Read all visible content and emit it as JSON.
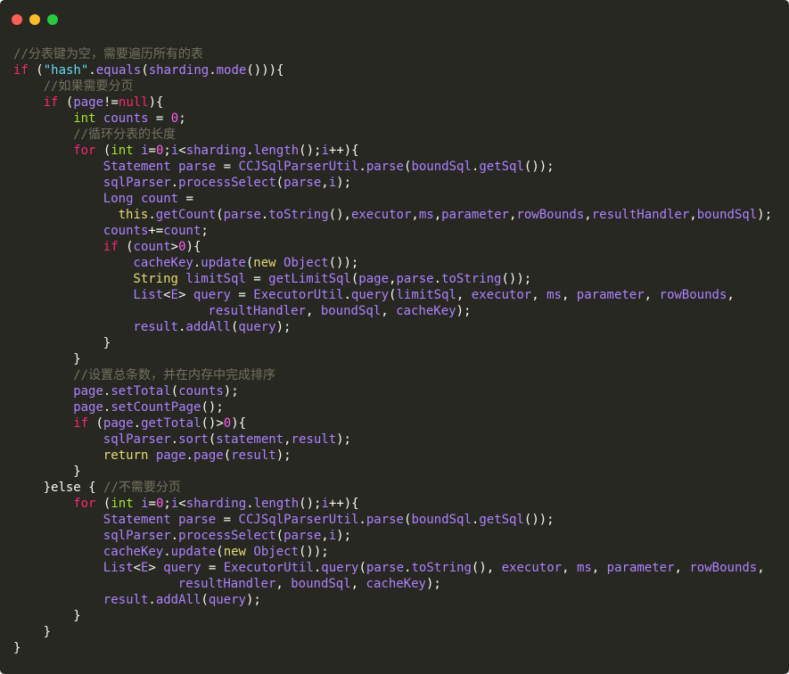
{
  "window": {
    "controls": {
      "close": "close",
      "minimize": "minimize",
      "maximize": "maximize"
    },
    "colors": {
      "close": "#ff5f56",
      "minimize": "#ffbd2e",
      "maximize": "#27c93f",
      "background": "#272822"
    }
  },
  "code_lines": [
    {
      "indent": 0,
      "tokens": [
        {
          "t": "//分表键为空，需要遍历所有的表",
          "c": "cm"
        }
      ]
    },
    {
      "indent": 0,
      "tokens": [
        {
          "t": "if",
          "c": "kw"
        },
        {
          "t": " ("
        },
        {
          "t": "\"hash\"",
          "c": "str"
        },
        {
          "t": "."
        },
        {
          "t": "equals",
          "c": "var"
        },
        {
          "t": "("
        },
        {
          "t": "sharding",
          "c": "var"
        },
        {
          "t": "."
        },
        {
          "t": "mode",
          "c": "var"
        },
        {
          "t": "())){"
        }
      ]
    },
    {
      "indent": 1,
      "tokens": [
        {
          "t": "//如果需要分页",
          "c": "cm"
        }
      ]
    },
    {
      "indent": 1,
      "tokens": [
        {
          "t": "if",
          "c": "kw"
        },
        {
          "t": " ("
        },
        {
          "t": "page",
          "c": "var"
        },
        {
          "t": "!="
        },
        {
          "t": "null",
          "c": "kw"
        },
        {
          "t": "){"
        }
      ]
    },
    {
      "indent": 2,
      "tokens": [
        {
          "t": "int",
          "c": "type"
        },
        {
          "t": " "
        },
        {
          "t": "counts",
          "c": "var"
        },
        {
          "t": " = "
        },
        {
          "t": "0",
          "c": "num"
        },
        {
          "t": ";"
        }
      ]
    },
    {
      "indent": 2,
      "tokens": [
        {
          "t": "//循环分表的长度",
          "c": "cm"
        }
      ]
    },
    {
      "indent": 2,
      "tokens": [
        {
          "t": "for",
          "c": "kw"
        },
        {
          "t": " ("
        },
        {
          "t": "int",
          "c": "type"
        },
        {
          "t": " "
        },
        {
          "t": "i",
          "c": "var"
        },
        {
          "t": "="
        },
        {
          "t": "0",
          "c": "num"
        },
        {
          "t": ";"
        },
        {
          "t": "i",
          "c": "var"
        },
        {
          "t": "<"
        },
        {
          "t": "sharding",
          "c": "var"
        },
        {
          "t": "."
        },
        {
          "t": "length",
          "c": "var"
        },
        {
          "t": "();"
        },
        {
          "t": "i",
          "c": "var"
        },
        {
          "t": "++){"
        }
      ]
    },
    {
      "indent": 3,
      "tokens": [
        {
          "t": "Statement",
          "c": "var"
        },
        {
          "t": " "
        },
        {
          "t": "parse",
          "c": "var"
        },
        {
          "t": " = "
        },
        {
          "t": "CCJSqlParserUtil",
          "c": "var"
        },
        {
          "t": "."
        },
        {
          "t": "parse",
          "c": "var"
        },
        {
          "t": "("
        },
        {
          "t": "boundSql",
          "c": "var"
        },
        {
          "t": "."
        },
        {
          "t": "getSql",
          "c": "var"
        },
        {
          "t": "());"
        }
      ]
    },
    {
      "indent": 3,
      "tokens": [
        {
          "t": "sqlParser",
          "c": "var"
        },
        {
          "t": "."
        },
        {
          "t": "processSelect",
          "c": "var"
        },
        {
          "t": "("
        },
        {
          "t": "parse",
          "c": "var"
        },
        {
          "t": ","
        },
        {
          "t": "i",
          "c": "var"
        },
        {
          "t": ");"
        }
      ]
    },
    {
      "indent": 3,
      "tokens": [
        {
          "t": "Long",
          "c": "var"
        },
        {
          "t": " "
        },
        {
          "t": "count",
          "c": "var"
        },
        {
          "t": " ="
        }
      ]
    },
    {
      "indent": 3,
      "pad": 2,
      "tokens": [
        {
          "t": "this",
          "c": "fn"
        },
        {
          "t": "."
        },
        {
          "t": "getCount",
          "c": "var"
        },
        {
          "t": "("
        },
        {
          "t": "parse",
          "c": "var"
        },
        {
          "t": "."
        },
        {
          "t": "toString",
          "c": "var"
        },
        {
          "t": "(),"
        },
        {
          "t": "executor",
          "c": "var"
        },
        {
          "t": ","
        },
        {
          "t": "ms",
          "c": "var"
        },
        {
          "t": ","
        },
        {
          "t": "parameter",
          "c": "var"
        },
        {
          "t": ","
        },
        {
          "t": "rowBounds",
          "c": "var"
        },
        {
          "t": ","
        },
        {
          "t": "resultHandler",
          "c": "var"
        },
        {
          "t": ","
        },
        {
          "t": "boundSql",
          "c": "var"
        },
        {
          "t": ");"
        }
      ]
    },
    {
      "indent": 3,
      "tokens": [
        {
          "t": "counts",
          "c": "var"
        },
        {
          "t": "+="
        },
        {
          "t": "count",
          "c": "var"
        },
        {
          "t": ";"
        }
      ]
    },
    {
      "indent": 3,
      "tokens": [
        {
          "t": "if",
          "c": "kw"
        },
        {
          "t": " ("
        },
        {
          "t": "count",
          "c": "var"
        },
        {
          "t": ">"
        },
        {
          "t": "0",
          "c": "num"
        },
        {
          "t": "){"
        }
      ]
    },
    {
      "indent": 4,
      "tokens": [
        {
          "t": "cacheKey",
          "c": "var"
        },
        {
          "t": "."
        },
        {
          "t": "update",
          "c": "var"
        },
        {
          "t": "("
        },
        {
          "t": "new",
          "c": "fn"
        },
        {
          "t": " "
        },
        {
          "t": "Object",
          "c": "var"
        },
        {
          "t": "());"
        }
      ]
    },
    {
      "indent": 4,
      "tokens": [
        {
          "t": "String",
          "c": "fn"
        },
        {
          "t": " "
        },
        {
          "t": "limitSql",
          "c": "var"
        },
        {
          "t": " = "
        },
        {
          "t": "getLimitSql",
          "c": "var"
        },
        {
          "t": "("
        },
        {
          "t": "page",
          "c": "var"
        },
        {
          "t": ","
        },
        {
          "t": "parse",
          "c": "var"
        },
        {
          "t": "."
        },
        {
          "t": "toString",
          "c": "var"
        },
        {
          "t": "());"
        }
      ]
    },
    {
      "indent": 4,
      "tokens": [
        {
          "t": "List",
          "c": "var"
        },
        {
          "t": "<"
        },
        {
          "t": "E",
          "c": "var"
        },
        {
          "t": "> "
        },
        {
          "t": "query",
          "c": "var"
        },
        {
          "t": " = "
        },
        {
          "t": "ExecutorUtil",
          "c": "var"
        },
        {
          "t": "."
        },
        {
          "t": "query",
          "c": "var"
        },
        {
          "t": "("
        },
        {
          "t": "limitSql",
          "c": "var"
        },
        {
          "t": ", "
        },
        {
          "t": "executor",
          "c": "var"
        },
        {
          "t": ", "
        },
        {
          "t": "ms",
          "c": "var"
        },
        {
          "t": ", "
        },
        {
          "t": "parameter",
          "c": "var"
        },
        {
          "t": ", "
        },
        {
          "t": "rowBounds",
          "c": "var"
        },
        {
          "t": ","
        }
      ]
    },
    {
      "indent": 4,
      "pad": 10,
      "tokens": [
        {
          "t": "resultHandler",
          "c": "var"
        },
        {
          "t": ", "
        },
        {
          "t": "boundSql",
          "c": "var"
        },
        {
          "t": ", "
        },
        {
          "t": "cacheKey",
          "c": "var"
        },
        {
          "t": ");"
        }
      ]
    },
    {
      "indent": 4,
      "tokens": [
        {
          "t": "result",
          "c": "var"
        },
        {
          "t": "."
        },
        {
          "t": "addAll",
          "c": "var"
        },
        {
          "t": "("
        },
        {
          "t": "query",
          "c": "var"
        },
        {
          "t": ");"
        }
      ]
    },
    {
      "indent": 3,
      "tokens": [
        {
          "t": "}"
        }
      ]
    },
    {
      "indent": 2,
      "tokens": [
        {
          "t": "}"
        }
      ]
    },
    {
      "indent": 2,
      "tokens": [
        {
          "t": "//设置总条数，并在内存中完成排序",
          "c": "cm"
        }
      ]
    },
    {
      "indent": 2,
      "tokens": [
        {
          "t": "page",
          "c": "var"
        },
        {
          "t": "."
        },
        {
          "t": "setTotal",
          "c": "var"
        },
        {
          "t": "("
        },
        {
          "t": "counts",
          "c": "var"
        },
        {
          "t": ");"
        }
      ]
    },
    {
      "indent": 2,
      "tokens": [
        {
          "t": "page",
          "c": "var"
        },
        {
          "t": "."
        },
        {
          "t": "setCountPage",
          "c": "var"
        },
        {
          "t": "();"
        }
      ]
    },
    {
      "indent": 2,
      "tokens": [
        {
          "t": "if",
          "c": "kw"
        },
        {
          "t": " ("
        },
        {
          "t": "page",
          "c": "var"
        },
        {
          "t": "."
        },
        {
          "t": "getTotal",
          "c": "var"
        },
        {
          "t": "()>"
        },
        {
          "t": "0",
          "c": "num"
        },
        {
          "t": "){"
        }
      ]
    },
    {
      "indent": 3,
      "tokens": [
        {
          "t": "sqlParser",
          "c": "var"
        },
        {
          "t": "."
        },
        {
          "t": "sort",
          "c": "var"
        },
        {
          "t": "("
        },
        {
          "t": "statement",
          "c": "var"
        },
        {
          "t": ","
        },
        {
          "t": "result",
          "c": "var"
        },
        {
          "t": ");"
        }
      ]
    },
    {
      "indent": 3,
      "tokens": [
        {
          "t": "return",
          "c": "fn"
        },
        {
          "t": " "
        },
        {
          "t": "page",
          "c": "var"
        },
        {
          "t": "."
        },
        {
          "t": "page",
          "c": "var"
        },
        {
          "t": "("
        },
        {
          "t": "result",
          "c": "var"
        },
        {
          "t": ");"
        }
      ]
    },
    {
      "indent": 2,
      "tokens": [
        {
          "t": "}"
        }
      ]
    },
    {
      "indent": 1,
      "tokens": [
        {
          "t": "}else { "
        },
        {
          "t": "//不需要分页",
          "c": "cm"
        }
      ]
    },
    {
      "indent": 2,
      "tokens": [
        {
          "t": "for",
          "c": "kw"
        },
        {
          "t": " ("
        },
        {
          "t": "int",
          "c": "type"
        },
        {
          "t": " "
        },
        {
          "t": "i",
          "c": "var"
        },
        {
          "t": "="
        },
        {
          "t": "0",
          "c": "num"
        },
        {
          "t": ";"
        },
        {
          "t": "i",
          "c": "var"
        },
        {
          "t": "<"
        },
        {
          "t": "sharding",
          "c": "var"
        },
        {
          "t": "."
        },
        {
          "t": "length",
          "c": "var"
        },
        {
          "t": "();"
        },
        {
          "t": "i",
          "c": "var"
        },
        {
          "t": "++){"
        }
      ]
    },
    {
      "indent": 3,
      "tokens": [
        {
          "t": "Statement",
          "c": "var"
        },
        {
          "t": " "
        },
        {
          "t": "parse",
          "c": "var"
        },
        {
          "t": " = "
        },
        {
          "t": "CCJSqlParserUtil",
          "c": "var"
        },
        {
          "t": "."
        },
        {
          "t": "parse",
          "c": "var"
        },
        {
          "t": "("
        },
        {
          "t": "boundSql",
          "c": "var"
        },
        {
          "t": "."
        },
        {
          "t": "getSql",
          "c": "var"
        },
        {
          "t": "());"
        }
      ]
    },
    {
      "indent": 3,
      "tokens": [
        {
          "t": "sqlParser",
          "c": "var"
        },
        {
          "t": "."
        },
        {
          "t": "processSelect",
          "c": "var"
        },
        {
          "t": "("
        },
        {
          "t": "parse",
          "c": "var"
        },
        {
          "t": ","
        },
        {
          "t": "i",
          "c": "var"
        },
        {
          "t": ");"
        }
      ]
    },
    {
      "indent": 3,
      "tokens": [
        {
          "t": "cacheKey",
          "c": "var"
        },
        {
          "t": "."
        },
        {
          "t": "update",
          "c": "var"
        },
        {
          "t": "("
        },
        {
          "t": "new",
          "c": "fn"
        },
        {
          "t": " "
        },
        {
          "t": "Object",
          "c": "var"
        },
        {
          "t": "());"
        }
      ]
    },
    {
      "indent": 3,
      "tokens": [
        {
          "t": "List",
          "c": "var"
        },
        {
          "t": "<"
        },
        {
          "t": "E",
          "c": "var"
        },
        {
          "t": "> "
        },
        {
          "t": "query",
          "c": "var"
        },
        {
          "t": " = "
        },
        {
          "t": "ExecutorUtil",
          "c": "var"
        },
        {
          "t": "."
        },
        {
          "t": "query",
          "c": "var"
        },
        {
          "t": "("
        },
        {
          "t": "parse",
          "c": "var"
        },
        {
          "t": "."
        },
        {
          "t": "toString",
          "c": "var"
        },
        {
          "t": "(), "
        },
        {
          "t": "executor",
          "c": "var"
        },
        {
          "t": ", "
        },
        {
          "t": "ms",
          "c": "var"
        },
        {
          "t": ", "
        },
        {
          "t": "parameter",
          "c": "var"
        },
        {
          "t": ", "
        },
        {
          "t": "rowBounds",
          "c": "var"
        },
        {
          "t": ","
        }
      ]
    },
    {
      "indent": 3,
      "pad": 10,
      "tokens": [
        {
          "t": "resultHandler",
          "c": "var"
        },
        {
          "t": ", "
        },
        {
          "t": "boundSql",
          "c": "var"
        },
        {
          "t": ", "
        },
        {
          "t": "cacheKey",
          "c": "var"
        },
        {
          "t": ");"
        }
      ]
    },
    {
      "indent": 3,
      "tokens": [
        {
          "t": "result",
          "c": "var"
        },
        {
          "t": "."
        },
        {
          "t": "addAll",
          "c": "var"
        },
        {
          "t": "("
        },
        {
          "t": "query",
          "c": "var"
        },
        {
          "t": ");"
        }
      ]
    },
    {
      "indent": 2,
      "tokens": [
        {
          "t": "}"
        }
      ]
    },
    {
      "indent": 1,
      "tokens": [
        {
          "t": "}"
        }
      ]
    },
    {
      "indent": 0,
      "tokens": [
        {
          "t": "}"
        }
      ]
    }
  ]
}
